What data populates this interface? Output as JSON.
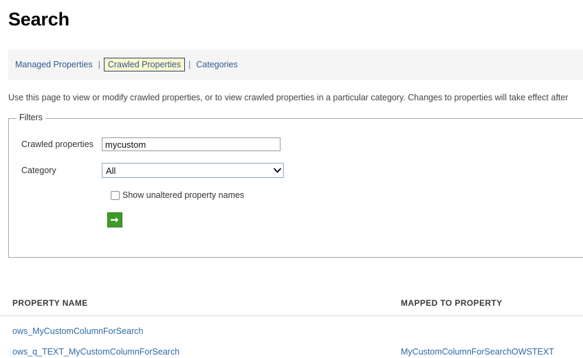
{
  "page": {
    "title": "Search",
    "description": "Use this page to view or modify crawled properties, or to view crawled properties in a particular category. Changes to properties will take effect after"
  },
  "tabs": {
    "separator": "|",
    "items": [
      {
        "label": "Managed Properties",
        "active": false
      },
      {
        "label": "Crawled Properties",
        "active": true
      },
      {
        "label": "Categories",
        "active": false
      }
    ]
  },
  "filters": {
    "legend": "Filters",
    "crawled_properties": {
      "label": "Crawled properties",
      "value": "mycustom",
      "placeholder": ""
    },
    "category": {
      "label": "Category",
      "value": "All"
    },
    "show_unaltered": {
      "label": "Show unaltered property names",
      "checked": false
    },
    "submit": {
      "icon": "arrow-right-icon",
      "color": "#3f9b28"
    }
  },
  "results": {
    "columns": [
      {
        "key": "property_name",
        "label": "PROPERTY NAME"
      },
      {
        "key": "mapped_to_property",
        "label": "MAPPED TO PROPERTY"
      }
    ],
    "rows": [
      {
        "property_name": "ows_MyCustomColumnForSearch",
        "mapped_to_property": ""
      },
      {
        "property_name": "ows_q_TEXT_MyCustomColumnForSearch",
        "mapped_to_property": "MyCustomColumnForSearchOWSTEXT"
      }
    ]
  },
  "colors": {
    "link": "#2f6aa8",
    "tab_active_bg": "#fdf6cd",
    "tab_active_border": "#26426b",
    "tabbar_bg": "#f5f5f5",
    "submit_green": "#3f9b28"
  }
}
